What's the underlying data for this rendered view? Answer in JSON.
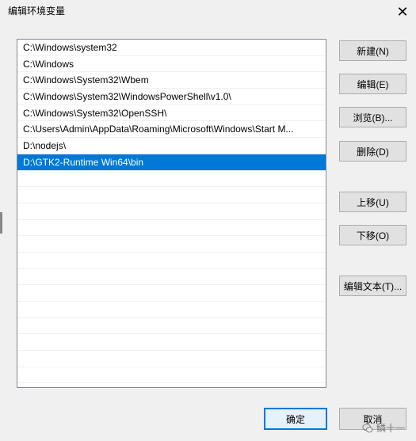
{
  "window": {
    "title": "编辑环境变量",
    "close_glyph": "✕"
  },
  "path_list": {
    "items": [
      "C:\\Windows\\system32",
      "C:\\Windows",
      "C:\\Windows\\System32\\Wbem",
      "C:\\Windows\\System32\\WindowsPowerShell\\v1.0\\",
      "C:\\Windows\\System32\\OpenSSH\\",
      "C:\\Users\\Admin\\AppData\\Roaming\\Microsoft\\Windows\\Start M...",
      "D:\\nodejs\\",
      "D:\\GTK2-Runtime Win64\\bin",
      "",
      "",
      "",
      "",
      "",
      "",
      "",
      "",
      "",
      "",
      "",
      "",
      ""
    ],
    "selected_index": 7
  },
  "buttons": {
    "new": "新建(N)",
    "edit": "编辑(E)",
    "browse": "浏览(B)...",
    "delete": "删除(D)",
    "move_up": "上移(U)",
    "move_down": "下移(O)",
    "edit_text": "编辑文本(T)...",
    "ok": "确定",
    "cancel": "取消"
  },
  "watermark": {
    "text": "鳞十一",
    "icon": "wechat-icon"
  }
}
